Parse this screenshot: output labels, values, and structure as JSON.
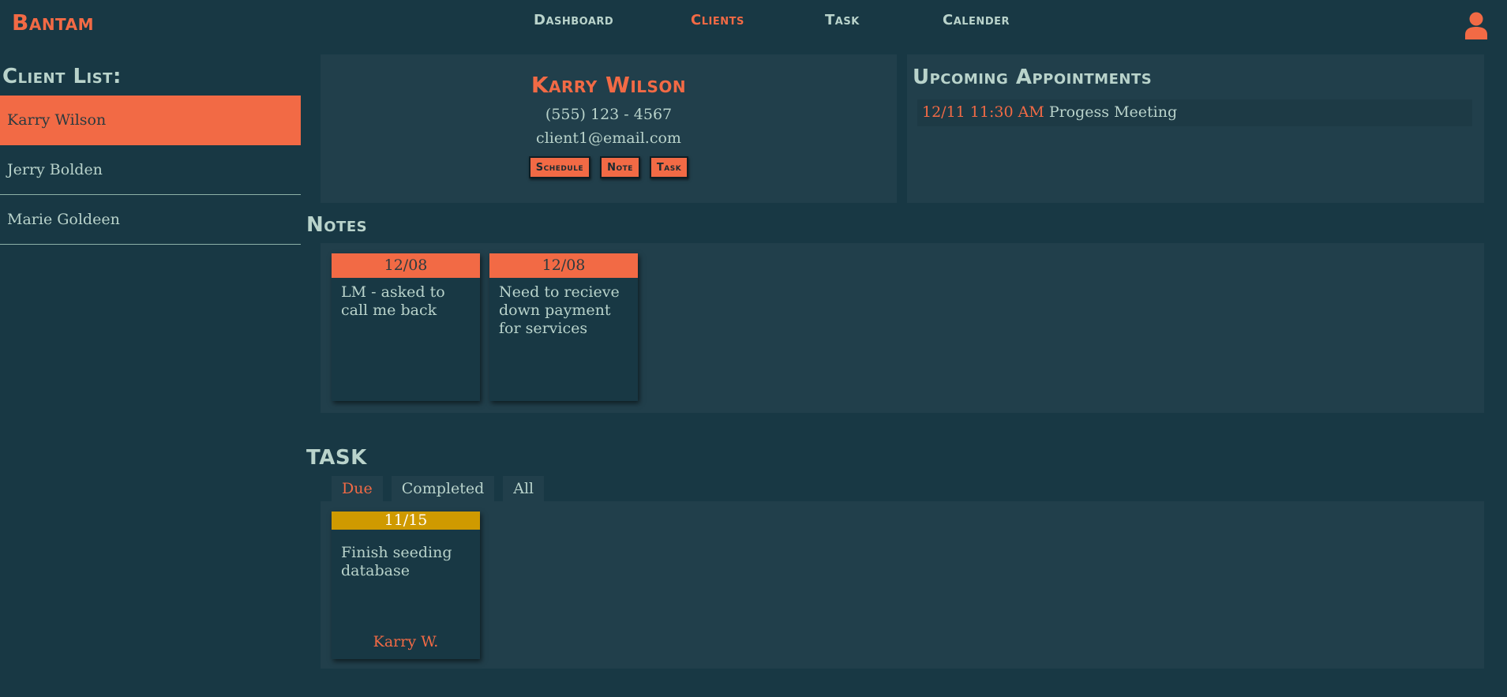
{
  "brand": "Bantam",
  "nav": {
    "items": [
      "Dashboard",
      "Clients",
      "Task",
      "Calender"
    ],
    "active": "Clients"
  },
  "colors": {
    "accent": "#f26a45",
    "background": "#183844",
    "panel": "#213f4b",
    "due_badge": "#cf9a00"
  },
  "icons": {
    "user": "user-icon"
  },
  "client_list": {
    "title": "Client List:",
    "clients": [
      "Karry Wilson",
      "Jerry Bolden",
      "Marie Goldeen"
    ],
    "selected": "Karry Wilson"
  },
  "profile": {
    "name": "Karry Wilson",
    "phone": "(555) 123 - 4567",
    "email": "client1@email.com",
    "buttons": {
      "schedule": "Schedule",
      "note": "Note",
      "task": "Task"
    }
  },
  "appointments": {
    "title": "Upcoming Appointments",
    "items": [
      {
        "time": "12/11 11:30 AM",
        "label": "Progess Meeting"
      }
    ]
  },
  "notes": {
    "title": "Notes",
    "items": [
      {
        "date": "12/08",
        "text": "LM - asked to call me back"
      },
      {
        "date": "12/08",
        "text": "Need to recieve down payment for services"
      }
    ]
  },
  "tasks": {
    "title": "TASK",
    "tabs": [
      "Due",
      "Completed",
      "All"
    ],
    "active_tab": "Due",
    "items": [
      {
        "date": "11/15",
        "text": "Finish seeding database",
        "assignee": "Karry W."
      }
    ]
  }
}
